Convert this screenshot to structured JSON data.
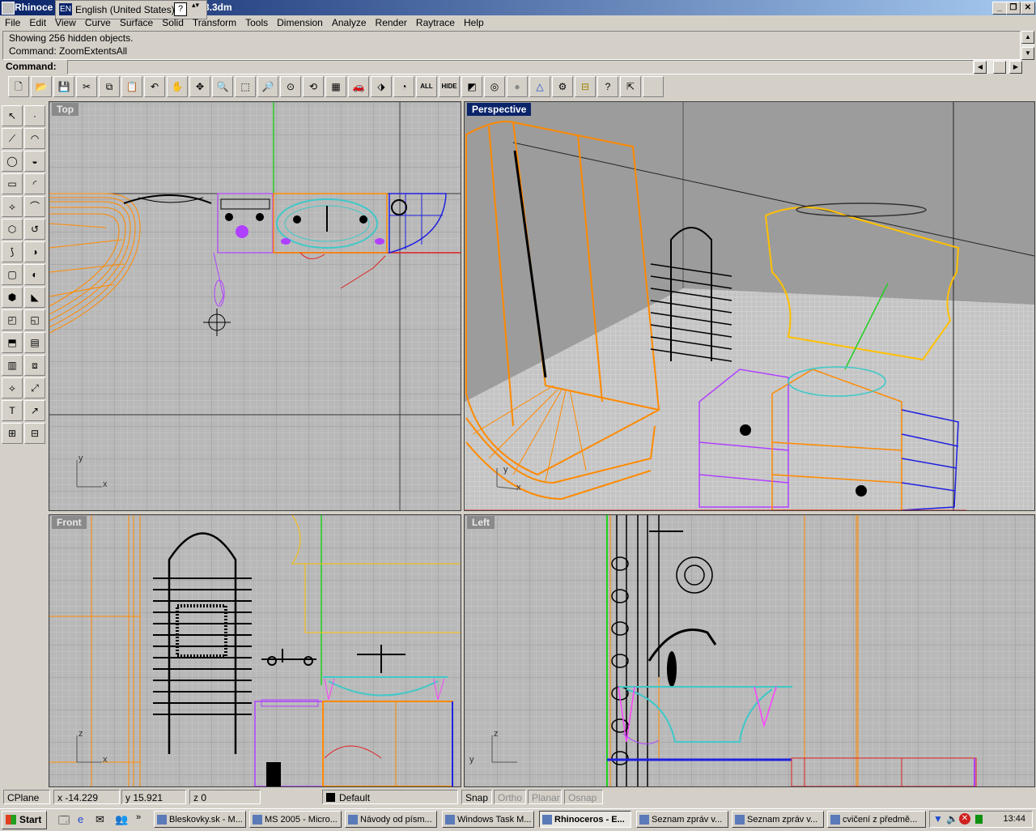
{
  "window": {
    "title_left": "Rhinoce",
    "title_right": "3.3dm",
    "min": "_",
    "restore": "❐",
    "close": "✕"
  },
  "langbar": {
    "code": "EN",
    "language": "English (United States)",
    "help": "?",
    "arrows": "▴▾"
  },
  "menu": [
    "File",
    "Edit",
    "View",
    "Curve",
    "Surface",
    "Solid",
    "Transform",
    "Tools",
    "Dimension",
    "Analyze",
    "Render",
    "Raytrace",
    "Help"
  ],
  "history": {
    "line1": "Showing 256 hidden objects.",
    "line2": "Command: ZoomExtentsAll"
  },
  "command": {
    "label": "Command:",
    "value": ""
  },
  "toolbar": {
    "buttons": [
      "🗋",
      "📂",
      "💾",
      "✂",
      "⧉",
      "📋",
      "↶",
      "✋",
      "✥",
      "🔍",
      "⬚",
      "🔎",
      "⊙",
      "⟲",
      "▦",
      "🚗",
      "⬗",
      "◔",
      "ALL",
      "HIDE",
      "◩",
      "◎",
      "●",
      "△",
      "⚙",
      "⊟",
      "?",
      "⇱"
    ]
  },
  "lefttools": {
    "buttons": [
      "↖",
      "·",
      "⟋",
      "◠",
      "◯",
      "◒",
      "▭",
      "◜",
      "⟡",
      "⌒",
      "⬡",
      "↺",
      "⟆",
      "◑",
      "▢",
      "◐",
      "⬢",
      "◣",
      "◰",
      "◱",
      "⬒",
      "▤",
      "▥",
      "⧈",
      "⟡",
      "⤢",
      "T",
      "↗",
      "⊞",
      "⊟",
      "▦",
      "⊞"
    ]
  },
  "viewports": {
    "top": {
      "label": "Top",
      "axis_x": "x",
      "axis_y": "y"
    },
    "perspective": {
      "label": "Perspective",
      "axis_x": "x",
      "axis_y": "y"
    },
    "front": {
      "label": "Front",
      "axis_x": "x",
      "axis_y": "z"
    },
    "left": {
      "label": "Left",
      "axis_x": "y",
      "axis_y": "z"
    }
  },
  "status": {
    "cplane": "CPlane",
    "x": "x -14.229",
    "y": "y 15.921",
    "z": "z 0",
    "layer": "Default",
    "snap": "Snap",
    "ortho": "Ortho",
    "planar": "Planar",
    "osnap": "Osnap"
  },
  "taskbar": {
    "start": "Start",
    "tasks": [
      "Bleskovky.sk - M...",
      "MS 2005 - Micro...",
      "Návody od písm...",
      "Windows Task M...",
      "Rhinoceros - E...",
      "Seznam zpráv v...",
      "Seznam zpráv v...",
      "cvičení z předmě..."
    ],
    "active_index": 4,
    "clock": "13:44"
  },
  "colors": {
    "title_start": "#0a246a",
    "viewport_bg": "#b4b4b4",
    "grid": "#a0a0a0",
    "shower": "#ff8a00",
    "cabinet": "#b040ff",
    "basin": "#40c8c8",
    "shelf": "#2020e0",
    "mirror": "#ffc000",
    "axis_red": "#e02020",
    "axis_green": "#20d020"
  }
}
